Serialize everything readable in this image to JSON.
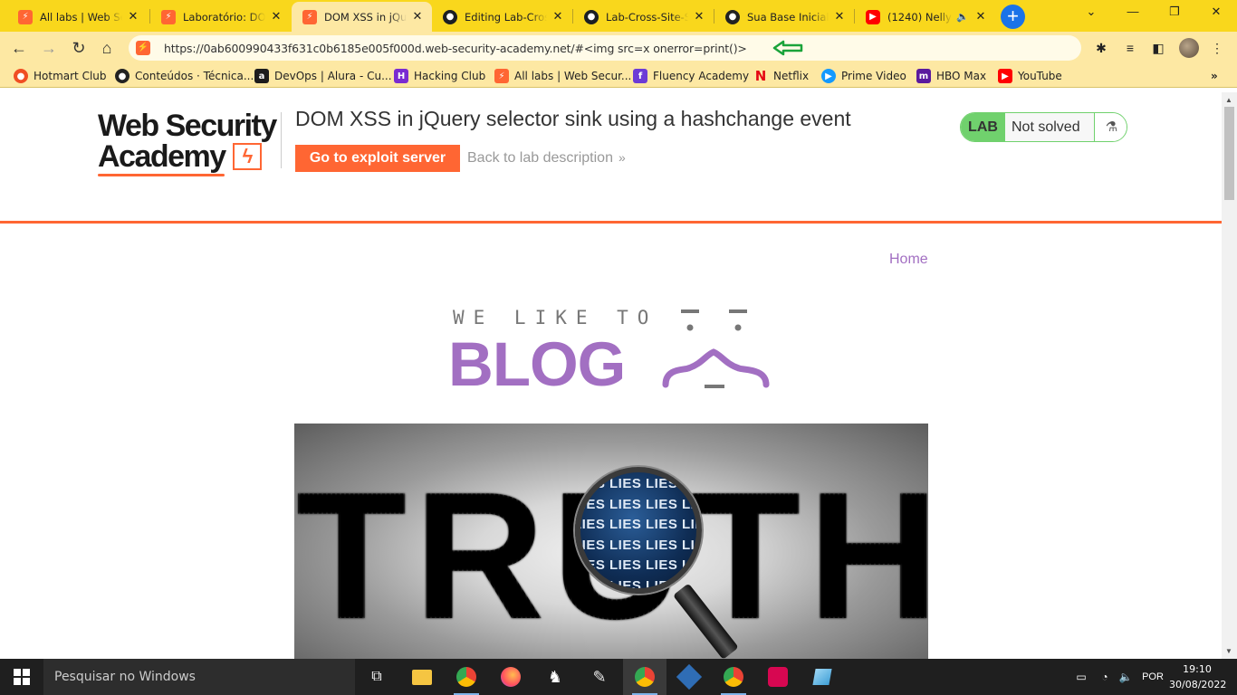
{
  "tabs": [
    {
      "title": "All labs | Web Security Academy",
      "icon": "portswigger-icon"
    },
    {
      "title": "Laboratório: DOM XSS",
      "icon": "portswigger-icon"
    },
    {
      "title": "DOM XSS in jQuery selector",
      "icon": "portswigger-icon",
      "active": true
    },
    {
      "title": "Editing Lab-Cross-Site",
      "icon": "github-icon"
    },
    {
      "title": "Lab-Cross-Site-Scripting",
      "icon": "github-icon"
    },
    {
      "title": "Sua Base Inicial",
      "icon": "lastpass-icon"
    },
    {
      "title": "(1240) Nelly",
      "icon": "youtube-icon"
    }
  ],
  "toolbar": {
    "url": "https://0ab600990433f631c0b6185e005f000d.web-security-academy.net/#<img src=x onerror=print()>"
  },
  "bookmarks": [
    {
      "label": "Hotmart Club",
      "color": "#f04e23"
    },
    {
      "label": "Conteúdos · Técnica...",
      "color": "#222222"
    },
    {
      "label": "DevOps | Alura - Cu...",
      "color": "#1c1c1c"
    },
    {
      "label": "Hacking Club",
      "color": "#7a2bd1"
    },
    {
      "label": "All labs | Web Secur...",
      "color": "#ff6633"
    },
    {
      "label": "Fluency Academy",
      "color": "#6c3bd6"
    },
    {
      "label": "Netflix",
      "color": "#e50914"
    },
    {
      "label": "Prime Video",
      "color": "#1399ff"
    },
    {
      "label": "HBO Max",
      "color": "#5a1a9e"
    },
    {
      "label": "YouTube",
      "color": "#ff0000"
    }
  ],
  "header": {
    "logo_line1": "Web Security",
    "logo_line2": "Academy",
    "lab_title": "DOM XSS in jQuery selector sink using a hashchange event",
    "exploit_button": "Go to exploit server",
    "back_link": "Back to lab description",
    "status_badge": "LAB",
    "status_text": "Not solved"
  },
  "nav": {
    "home": "Home"
  },
  "blog_logo": {
    "small": "WE LIKE TO",
    "big": "BLOG"
  },
  "hero": {
    "word": "TRUTH",
    "lens_word": "LIES"
  },
  "taskbar": {
    "search_placeholder": "Pesquisar no Windows",
    "language": "POR",
    "time": "19:10",
    "date": "30/08/2022"
  },
  "colors": {
    "accent": "#ff6633",
    "chrome_frame": "#f9d71c",
    "lab_green": "#70d16d",
    "blog_purple": "#a26fc2"
  }
}
